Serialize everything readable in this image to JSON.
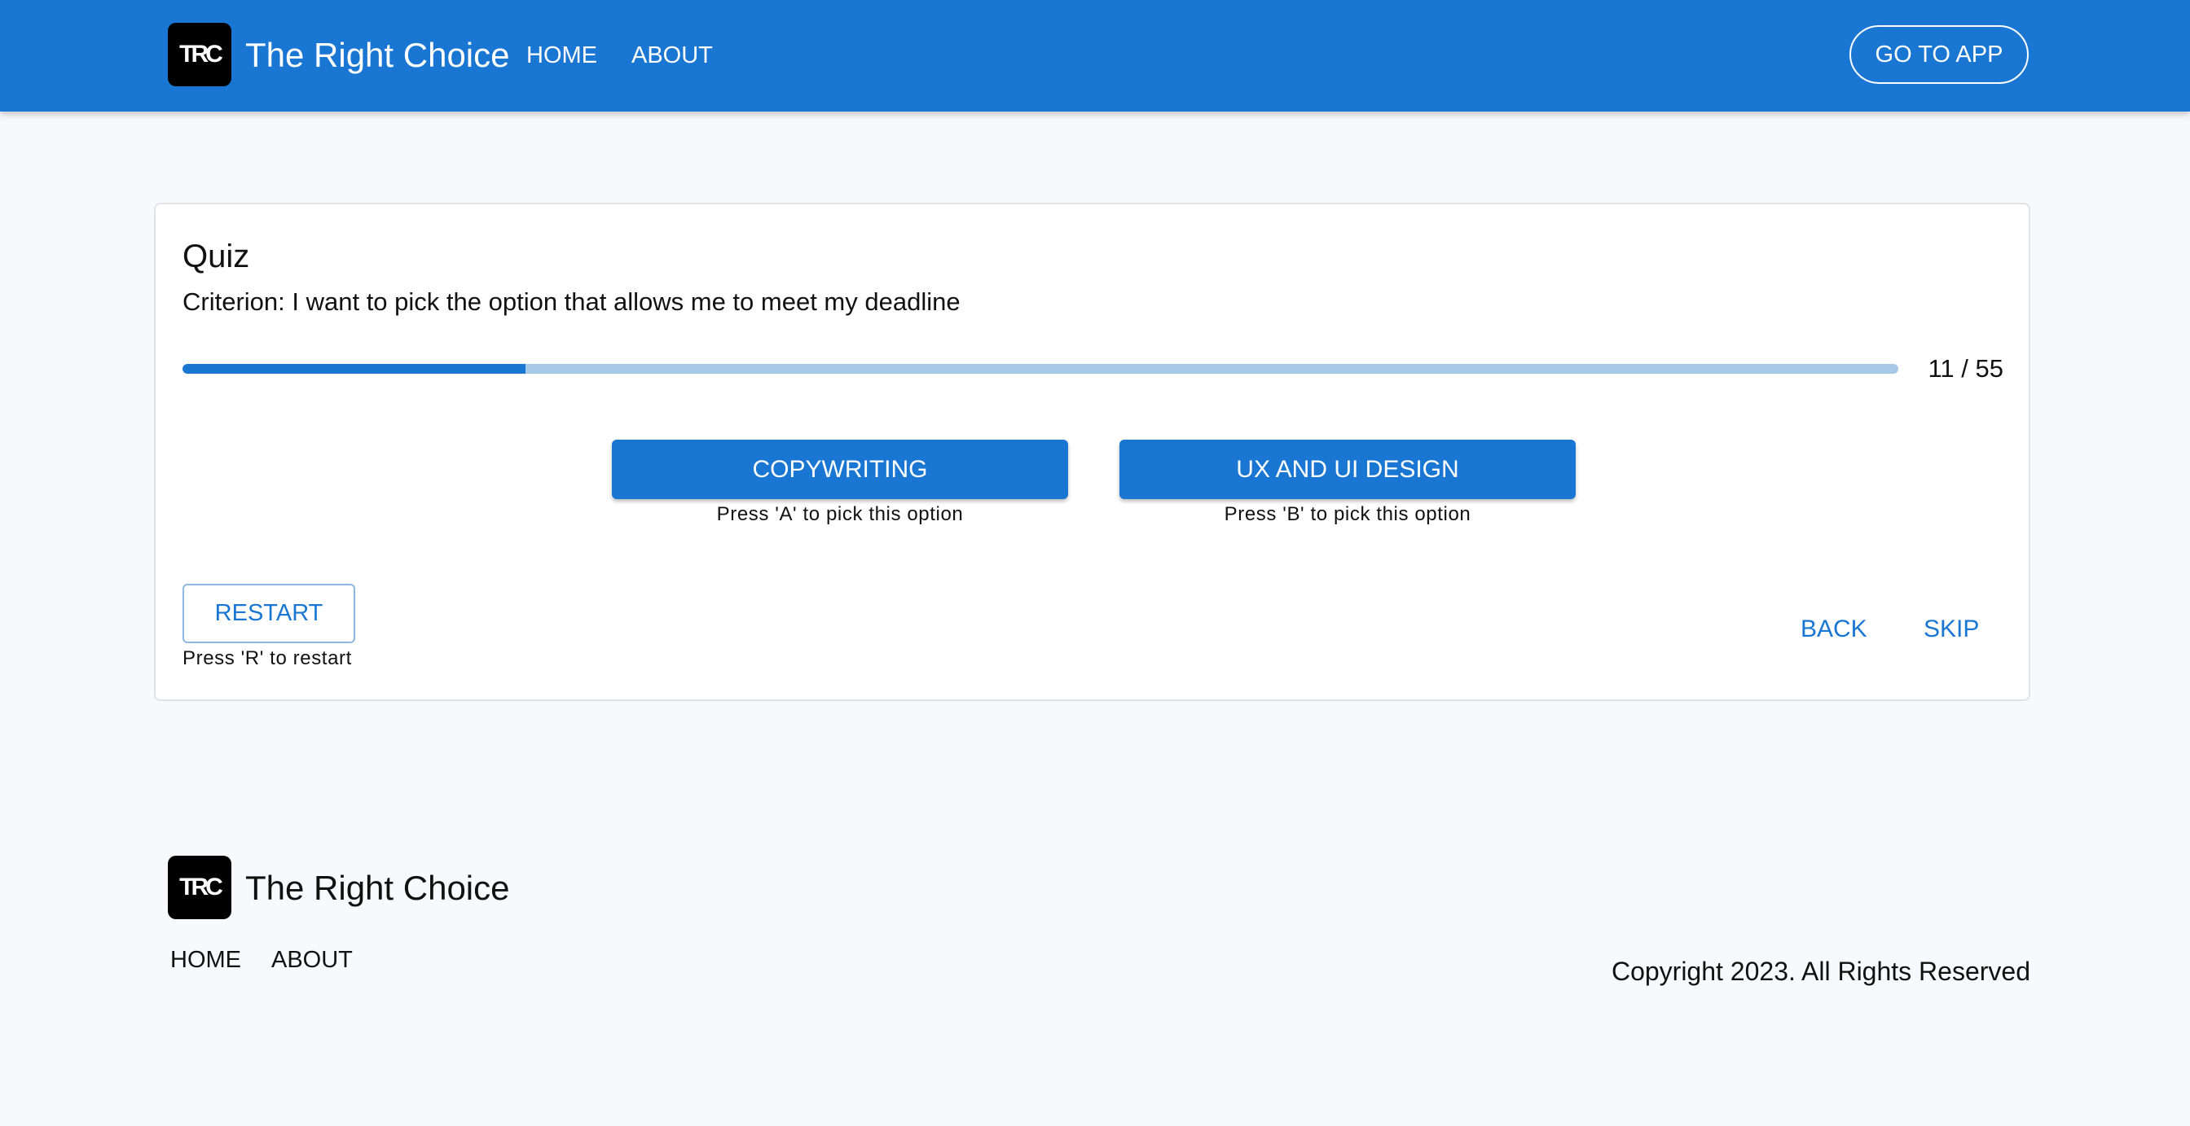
{
  "header": {
    "logo_text": "TRC",
    "brand": "The Right Choice",
    "nav": [
      {
        "label": "HOME"
      },
      {
        "label": "ABOUT"
      }
    ],
    "cta_label": "GO TO APP"
  },
  "quiz": {
    "title": "Quiz",
    "criterion": "Criterion: I want to pick the option that allows me to meet my deadline",
    "progress": {
      "current": 11,
      "total": 55,
      "label": "11 / 55"
    },
    "options": [
      {
        "label": "COPYWRITING",
        "hint": "Press 'A' to pick this option"
      },
      {
        "label": "UX AND UI DESIGN",
        "hint": "Press 'B' to pick this option"
      }
    ],
    "restart_label": "RESTART",
    "restart_hint": "Press 'R' to restart",
    "back_label": "BACK",
    "skip_label": "SKIP"
  },
  "footer": {
    "logo_text": "TRC",
    "brand": "The Right Choice",
    "nav": [
      {
        "label": "HOME"
      },
      {
        "label": "ABOUT"
      }
    ],
    "copyright": "Copyright 2023. All Rights Reserved"
  },
  "colors": {
    "primary": "#1976d2",
    "progress_track": "#a7c9e8",
    "background": "#f7f9fc",
    "logo_bg": "#000000"
  }
}
